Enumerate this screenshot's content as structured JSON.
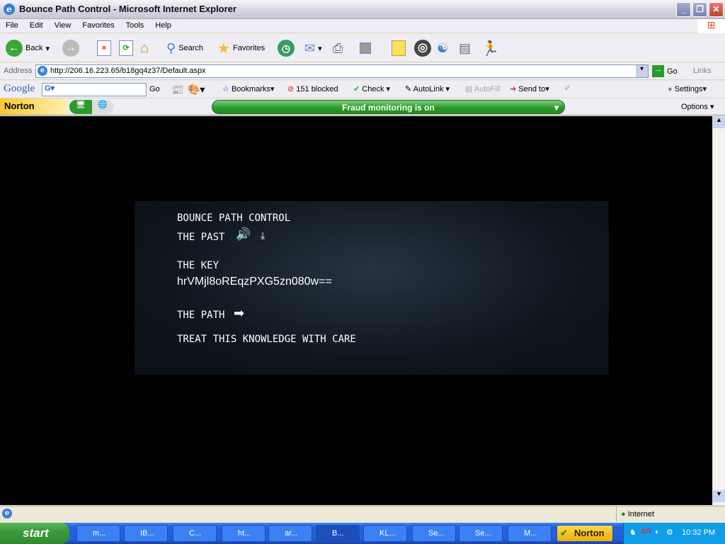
{
  "window": {
    "title": "Bounce Path Control - Microsoft Internet Explorer"
  },
  "menu": [
    "File",
    "Edit",
    "View",
    "Favorites",
    "Tools",
    "Help"
  ],
  "toolbar": {
    "back": "Back",
    "search": "Search",
    "favorites": "Favorites"
  },
  "address": {
    "label": "Address",
    "url": "http://206.16.223.65/b18gq4z37/Default.aspx",
    "go": "Go",
    "links": "Links"
  },
  "google_bar": {
    "logo": "Google",
    "go": "Go",
    "bookmarks": "Bookmarks",
    "blocked": "151 blocked",
    "check": "Check",
    "autolink": "AutoLink",
    "autofill": "AutoFill",
    "send_to": "Send to",
    "settings": "Settings"
  },
  "norton_bar": {
    "brand": "Norton",
    "fraud_status": "Fraud monitoring is on",
    "options": "Options"
  },
  "page": {
    "title": "BOUNCE PATH CONTROL",
    "past": "THE PAST",
    "key_label": "THE KEY",
    "key": "hrVMjl8oREqzPXG5zn080w==",
    "path": "THE PATH",
    "warning": "TREAT THIS KNOWLEDGE WITH CARE"
  },
  "status": {
    "zone": "Internet"
  },
  "taskbar": {
    "start": "start",
    "tasks": [
      "m...",
      "IB...",
      "C...",
      "ht...",
      "ar...",
      "B...",
      "KL...",
      "Se...",
      "Se...",
      "M..."
    ],
    "norton": "Norton",
    "clock": "10:32 PM"
  }
}
